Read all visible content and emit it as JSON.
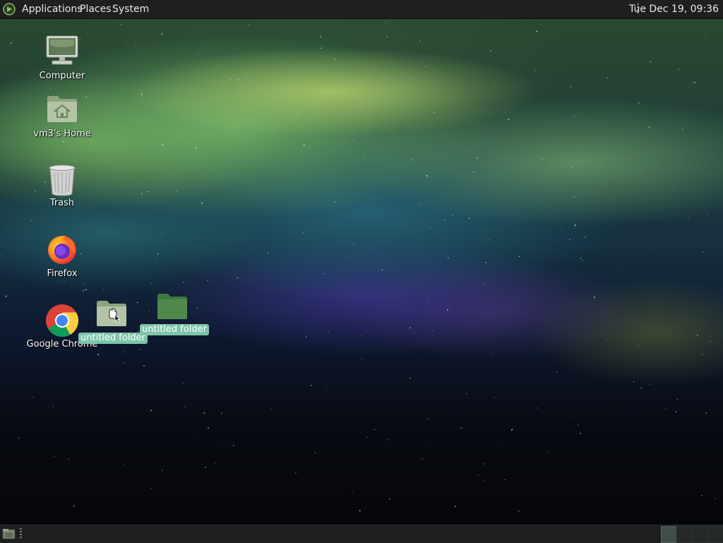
{
  "top_panel": {
    "menus": [
      "Applications",
      "Places",
      "System"
    ],
    "clock": "Tue Dec 19, 09:36"
  },
  "desktop": {
    "icons": [
      {
        "label": "Computer",
        "icon": "computer-icon"
      },
      {
        "label": "vm3's Home",
        "icon": "home-folder-icon"
      },
      {
        "label": "Trash",
        "icon": "trash-icon"
      },
      {
        "label": "Firefox",
        "icon": "firefox-icon"
      },
      {
        "label": "Google Chrome",
        "icon": "chrome-icon"
      },
      {
        "label": "untitled folder",
        "icon": "folder-icon"
      },
      {
        "label": "untitled folder",
        "icon": "folder-icon"
      }
    ]
  },
  "bottom_panel": {
    "show_desktop_icon": "show-desktop-icon",
    "workspaces": 4
  },
  "colors": {
    "panel_bg": "#1e1f20",
    "selection": "#7ec4ad",
    "folder_green": "#4f8a4c"
  }
}
